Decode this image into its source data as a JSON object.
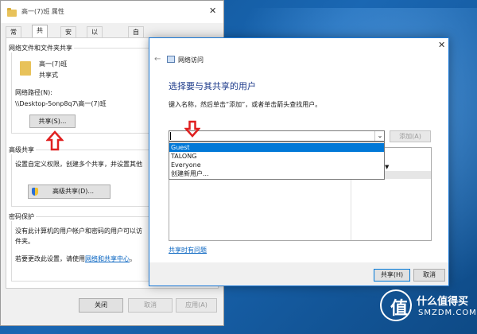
{
  "props_dialog": {
    "title": "高一(7)班 属性",
    "tabs": [
      "常规",
      "共享",
      "安全",
      "以前的版本",
      "自定义"
    ],
    "network_group_label": "网络文件和文件夹共享",
    "folder_name": "高一(7)班",
    "share_state": "共享式",
    "network_path_label": "网络路径(N):",
    "network_path": "\\\\Desktop-5onp8q7\\高一(7)班",
    "share_button": "共享(S)...",
    "advanced_group_label": "高级共享",
    "advanced_desc": "设置自定义权限，创建多个共享，并设置其他",
    "advanced_button": "高级共享(D)...",
    "password_group_label": "密码保护",
    "password_desc_1": "没有此计算机的用户帐户和密码的用户可以访",
    "password_desc_2": "件夹。",
    "password_change_text": "若要更改此设置，请使用",
    "password_link": "网络和共享中心",
    "password_tail": "。",
    "close_button": "关闭",
    "cancel_button": "取消",
    "apply_button": "应用(A)"
  },
  "network_access": {
    "title": "网络访问",
    "heading": "选择要与其共享的用户",
    "instruction": "键入名称，然后单击“添加”，或者单击箭头查找用户。",
    "combo_value": "",
    "add_button": "添加(A)",
    "dropdown_items": [
      "Guest",
      "TALONG",
      "Everyone",
      "创建新用户..."
    ],
    "selected_index": 0,
    "help_link": "共享时有问题",
    "share_button": "共享(H)",
    "cancel_button": "取消"
  },
  "watermark": {
    "brand_cn": "什么值得买",
    "brand_en": "SMZDM.COM"
  },
  "colors": {
    "accent": "#0078d7",
    "arrow_red": "#e02020",
    "link": "#0a66c2"
  }
}
